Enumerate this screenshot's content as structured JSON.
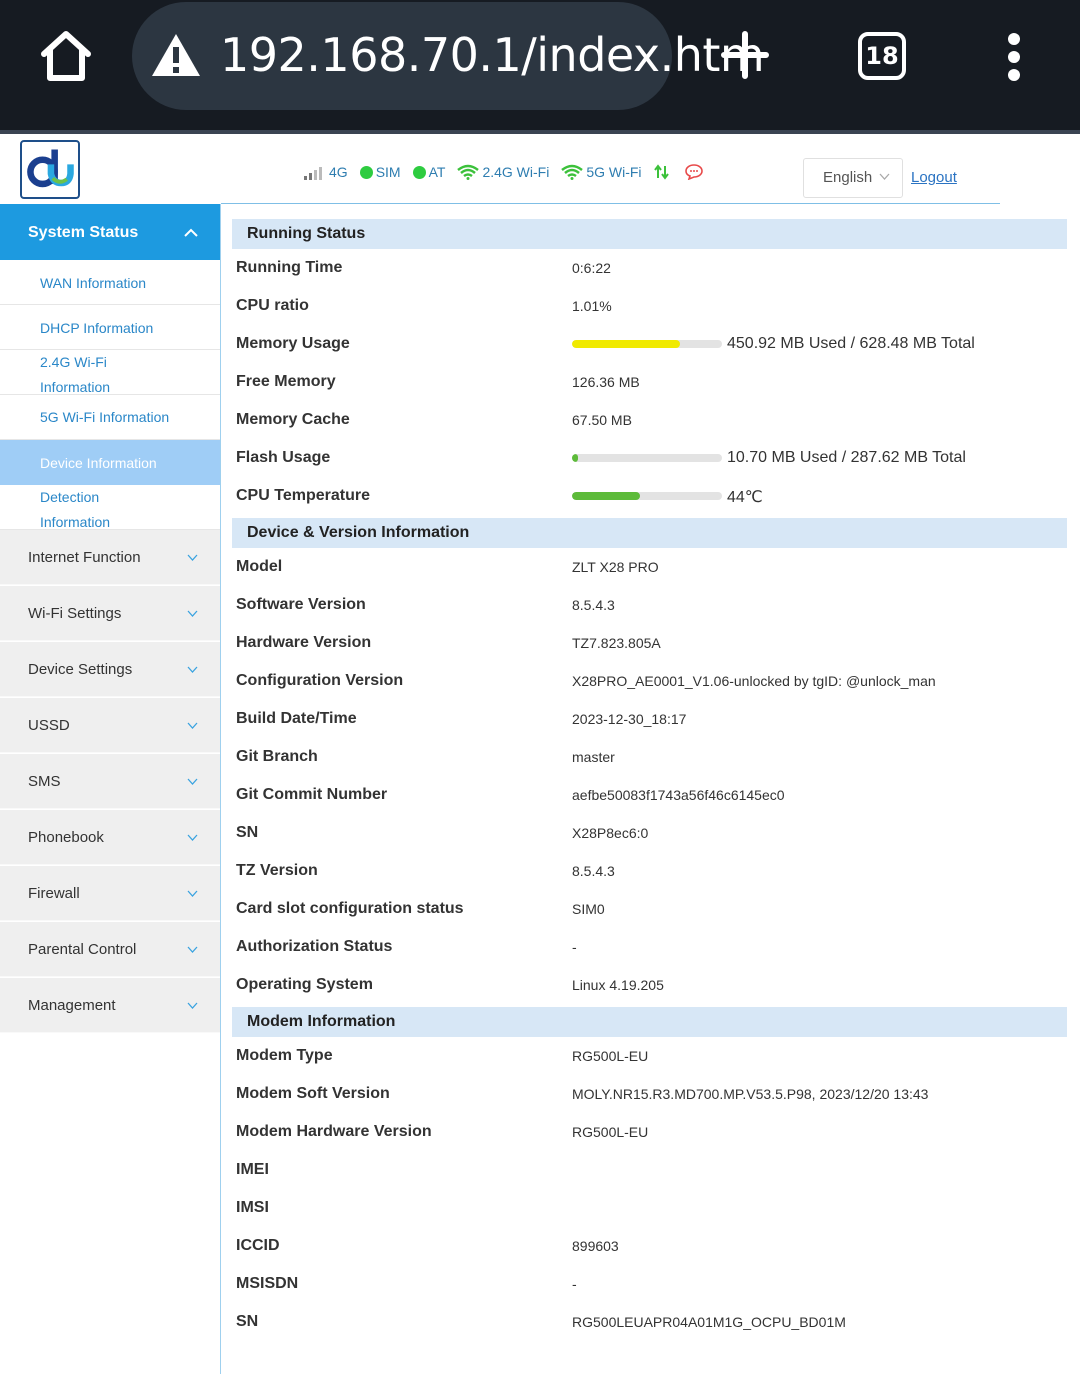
{
  "browser": {
    "url": "192.168.70.1/index.htm",
    "tab_count": "18"
  },
  "header": {
    "status_items": {
      "network": "4G",
      "sim": "SIM",
      "at": "AT",
      "wifi_24": "2.4G Wi-Fi",
      "wifi_5": "5G Wi-Fi"
    },
    "language": "English",
    "logout": "Logout"
  },
  "sidebar": {
    "title": "System Status",
    "sub_items": [
      "WAN Information",
      "DHCP Information",
      "2.4G Wi-Fi Information",
      "5G Wi-Fi Information",
      "Device Information",
      "Detection Information"
    ],
    "active_sub_item": "Device Information",
    "menu_items": [
      "Internet Function",
      "Wi-Fi Settings",
      "Device Settings",
      "USSD",
      "SMS",
      "Phonebook",
      "Firewall",
      "Parental Control",
      "Management"
    ]
  },
  "running_status": {
    "title": "Running Status",
    "running_time_label": "Running Time",
    "running_time": "0:6:22",
    "cpu_ratio_label": "CPU ratio",
    "cpu_ratio": "1.01%",
    "memory_usage_label": "Memory Usage",
    "memory_usage": "450.92 MB Used / 628.48 MB Total",
    "memory_usage_fraction": 0.717,
    "free_memory_label": "Free Memory",
    "free_memory": "126.36 MB",
    "memory_cache_label": "Memory Cache",
    "memory_cache": "67.50 MB",
    "flash_usage_label": "Flash Usage",
    "flash_usage": "10.70 MB Used / 287.62 MB Total",
    "flash_usage_fraction": 0.037,
    "cpu_temp_label": "CPU Temperature",
    "cpu_temp": "44℃",
    "cpu_temp_fraction": 0.45
  },
  "device_info": {
    "title": "Device & Version Information",
    "rows": [
      {
        "label": "Model",
        "value": "ZLT X28 PRO"
      },
      {
        "label": "Software Version",
        "value": "8.5.4.3"
      },
      {
        "label": "Hardware Version",
        "value": "TZ7.823.805A"
      },
      {
        "label": "Configuration Version",
        "value": "X28PRO_AE0001_V1.06-unlocked by tgID: @unlock_man"
      },
      {
        "label": "Build Date/Time",
        "value": "2023-12-30_18:17"
      },
      {
        "label": "Git Branch",
        "value": "master"
      },
      {
        "label": "Git Commit Number",
        "value": "aefbe50083f1743a56f46c6145ec0"
      },
      {
        "label": "SN",
        "value": "X28P8ec6:0"
      },
      {
        "label": "TZ Version",
        "value": "8.5.4.3"
      },
      {
        "label": "Card slot configuration status",
        "value": "SIM0"
      },
      {
        "label": "Authorization Status",
        "value": "-"
      },
      {
        "label": "Operating System",
        "value": "Linux 4.19.205"
      }
    ]
  },
  "modem_info": {
    "title": "Modem Information",
    "rows": [
      {
        "label": "Modem Type",
        "value": "RG500L-EU"
      },
      {
        "label": "Modem Soft Version",
        "value": "MOLY.NR15.R3.MD700.MP.V53.5.P98, 2023/12/20 13:43"
      },
      {
        "label": "Modem Hardware Version",
        "value": "RG500L-EU"
      },
      {
        "label": "IMEI",
        "value": ""
      },
      {
        "label": "IMSI",
        "value": ""
      },
      {
        "label": "ICCID",
        "value": "899603"
      },
      {
        "label": "MSISDN",
        "value": "-"
      },
      {
        "label": "SN",
        "value": "RG500LEUAPR04A01M1G_OCPU_BD01M"
      }
    ]
  },
  "colors": {
    "accent": "#1d9ae0",
    "memory_bar": "#f0ea00",
    "temp_bar": "#5dbb3a",
    "flash_bar": "#5dbb3a"
  }
}
